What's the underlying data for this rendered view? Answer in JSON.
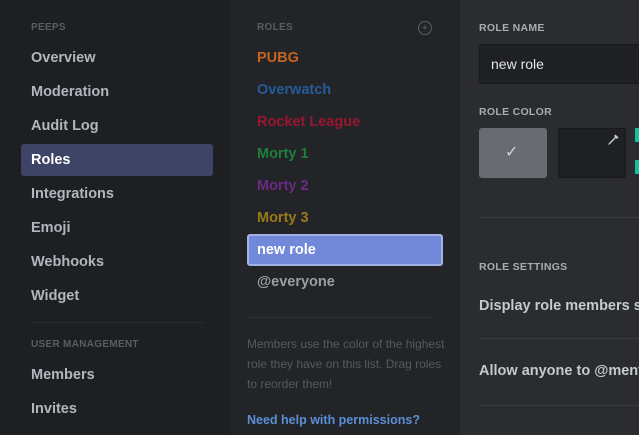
{
  "sidebar": {
    "peeps_header": "PEEPS",
    "items": [
      {
        "label": "Overview"
      },
      {
        "label": "Moderation"
      },
      {
        "label": "Audit Log"
      },
      {
        "label": "Roles"
      },
      {
        "label": "Integrations"
      },
      {
        "label": "Emoji"
      },
      {
        "label": "Webhooks"
      },
      {
        "label": "Widget"
      }
    ],
    "user_mgmt_header": "USER MANAGEMENT",
    "user_items": [
      {
        "label": "Members"
      },
      {
        "label": "Invites"
      }
    ]
  },
  "roles": {
    "header": "ROLES",
    "items": [
      {
        "label": "PUBG",
        "color": "#c5631f"
      },
      {
        "label": "Overwatch",
        "color": "#245b99"
      },
      {
        "label": "Rocket League",
        "color": "#99162f"
      },
      {
        "label": "Morty 1",
        "color": "#1d7f3a"
      },
      {
        "label": "Morty 2",
        "color": "#6b2a86"
      },
      {
        "label": "Morty 3",
        "color": "#9a7a16"
      },
      {
        "label": "new role",
        "color": "#ffffff"
      },
      {
        "label": "@everyone",
        "color": "#9a9ea5"
      }
    ],
    "help_text": "Members use the color of the highest role they have on this list. Drag roles to reorder them!",
    "permissions_link": "Need help with permissions?"
  },
  "edit": {
    "role_name_label": "ROLE NAME",
    "role_name_value": "new role",
    "role_color_label": "ROLE COLOR",
    "role_settings_label": "ROLE SETTINGS",
    "setting_display": "Display role members se",
    "setting_mention": "Allow anyone to @ment"
  },
  "colors": {
    "accent": "#7289da",
    "link": "#5a8fd6"
  }
}
